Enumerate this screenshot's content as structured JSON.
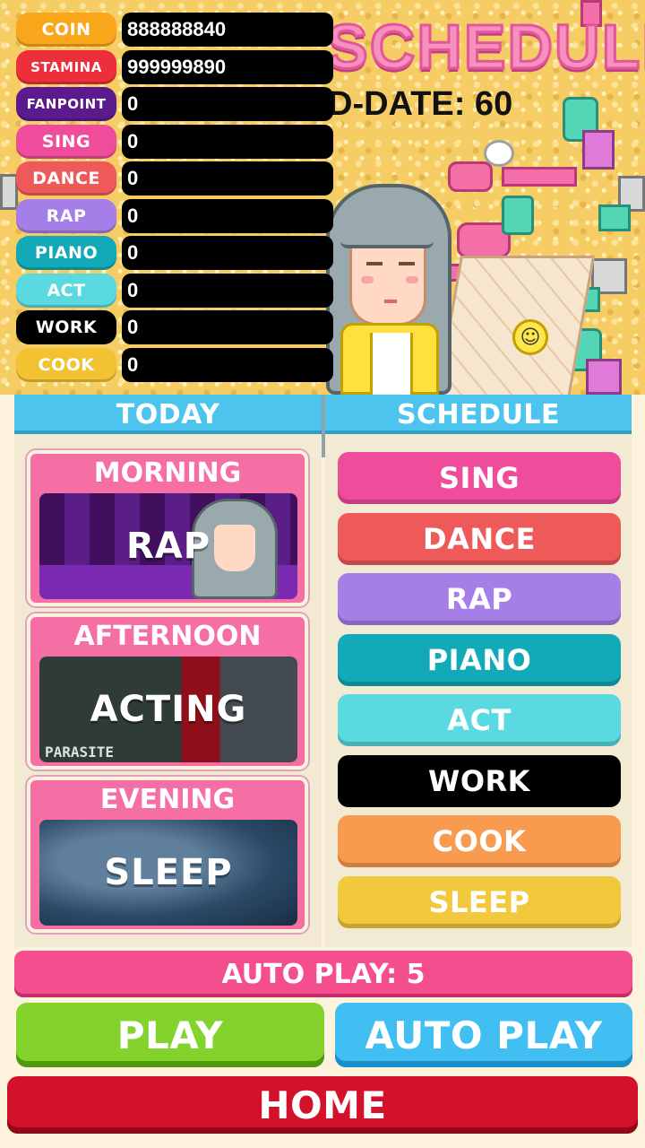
{
  "stats": [
    {
      "label": "COIN",
      "value": "888888840",
      "color": "#f9a61a"
    },
    {
      "label": "STAMINA",
      "value": "999999890",
      "color": "#ec2f3a"
    },
    {
      "label": "FANPOINT",
      "value": "0",
      "color": "#5b1b8f"
    },
    {
      "label": "SING",
      "value": "0",
      "color": "#ef4c9c"
    },
    {
      "label": "DANCE",
      "value": "0",
      "color": "#ee5a5a"
    },
    {
      "label": "RAP",
      "value": "0",
      "color": "#a57ee8"
    },
    {
      "label": "PIANO",
      "value": "0",
      "color": "#12a9b8"
    },
    {
      "label": "ACT",
      "value": "0",
      "color": "#5ad9e0"
    },
    {
      "label": "WORK",
      "value": "0",
      "color": "#000000"
    },
    {
      "label": "COOK",
      "value": "0",
      "color": "#f2c233"
    }
  ],
  "header": {
    "title": "SCHEDULE",
    "ddate": "D-DATE: 60"
  },
  "today": {
    "title": "TODAY",
    "slots": [
      {
        "period": "MORNING",
        "activity": "RAP",
        "image": "rap-scene"
      },
      {
        "period": "AFTERNOON",
        "activity": "ACTING",
        "image": "acting-scene",
        "sign": "PARASITE"
      },
      {
        "period": "EVENING",
        "activity": "SLEEP",
        "image": "sleep-scene"
      }
    ]
  },
  "schedule": {
    "title": "SCHEDULE",
    "options": [
      {
        "label": "SING",
        "color": "#ef4c9c"
      },
      {
        "label": "DANCE",
        "color": "#ee5a5a"
      },
      {
        "label": "RAP",
        "color": "#a57ee8"
      },
      {
        "label": "PIANO",
        "color": "#12a9b8"
      },
      {
        "label": "ACT",
        "color": "#5ad9e0"
      },
      {
        "label": "WORK",
        "color": "#000000"
      },
      {
        "label": "COOK",
        "color": "#f99b4f"
      },
      {
        "label": "SLEEP",
        "color": "#f2c93c"
      }
    ]
  },
  "autoplay_count": "AUTO PLAY: 5",
  "buttons": {
    "play": "PLAY",
    "auto_play": "AUTO PLAY",
    "home": "HOME"
  }
}
